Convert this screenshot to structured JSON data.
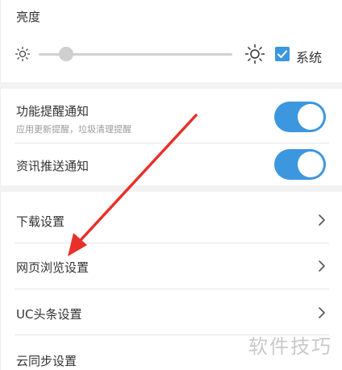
{
  "brightness": {
    "title": "亮度",
    "level": 0.14,
    "system_checked": true,
    "system_label": "系统"
  },
  "notifications": {
    "function": {
      "title": "功能提醒通知",
      "subtitle": "应用更新提醒，垃圾清理提醒",
      "on": true
    },
    "news": {
      "title": "资讯推送通知",
      "on": true
    }
  },
  "menu": {
    "download": "下载设置",
    "web": "网页浏览设置",
    "uc": "UC头条设置",
    "cloud": "云同步设置"
  },
  "icons": {
    "sun_small": "sun-icon",
    "sun_big": "sun-icon",
    "chevron": "chevron-right-icon",
    "check": "check-icon"
  },
  "colors": {
    "accent": "#3c97df",
    "arrow": "#e8302a",
    "watermark": "#c9c9c9"
  },
  "watermark": "软件技巧"
}
